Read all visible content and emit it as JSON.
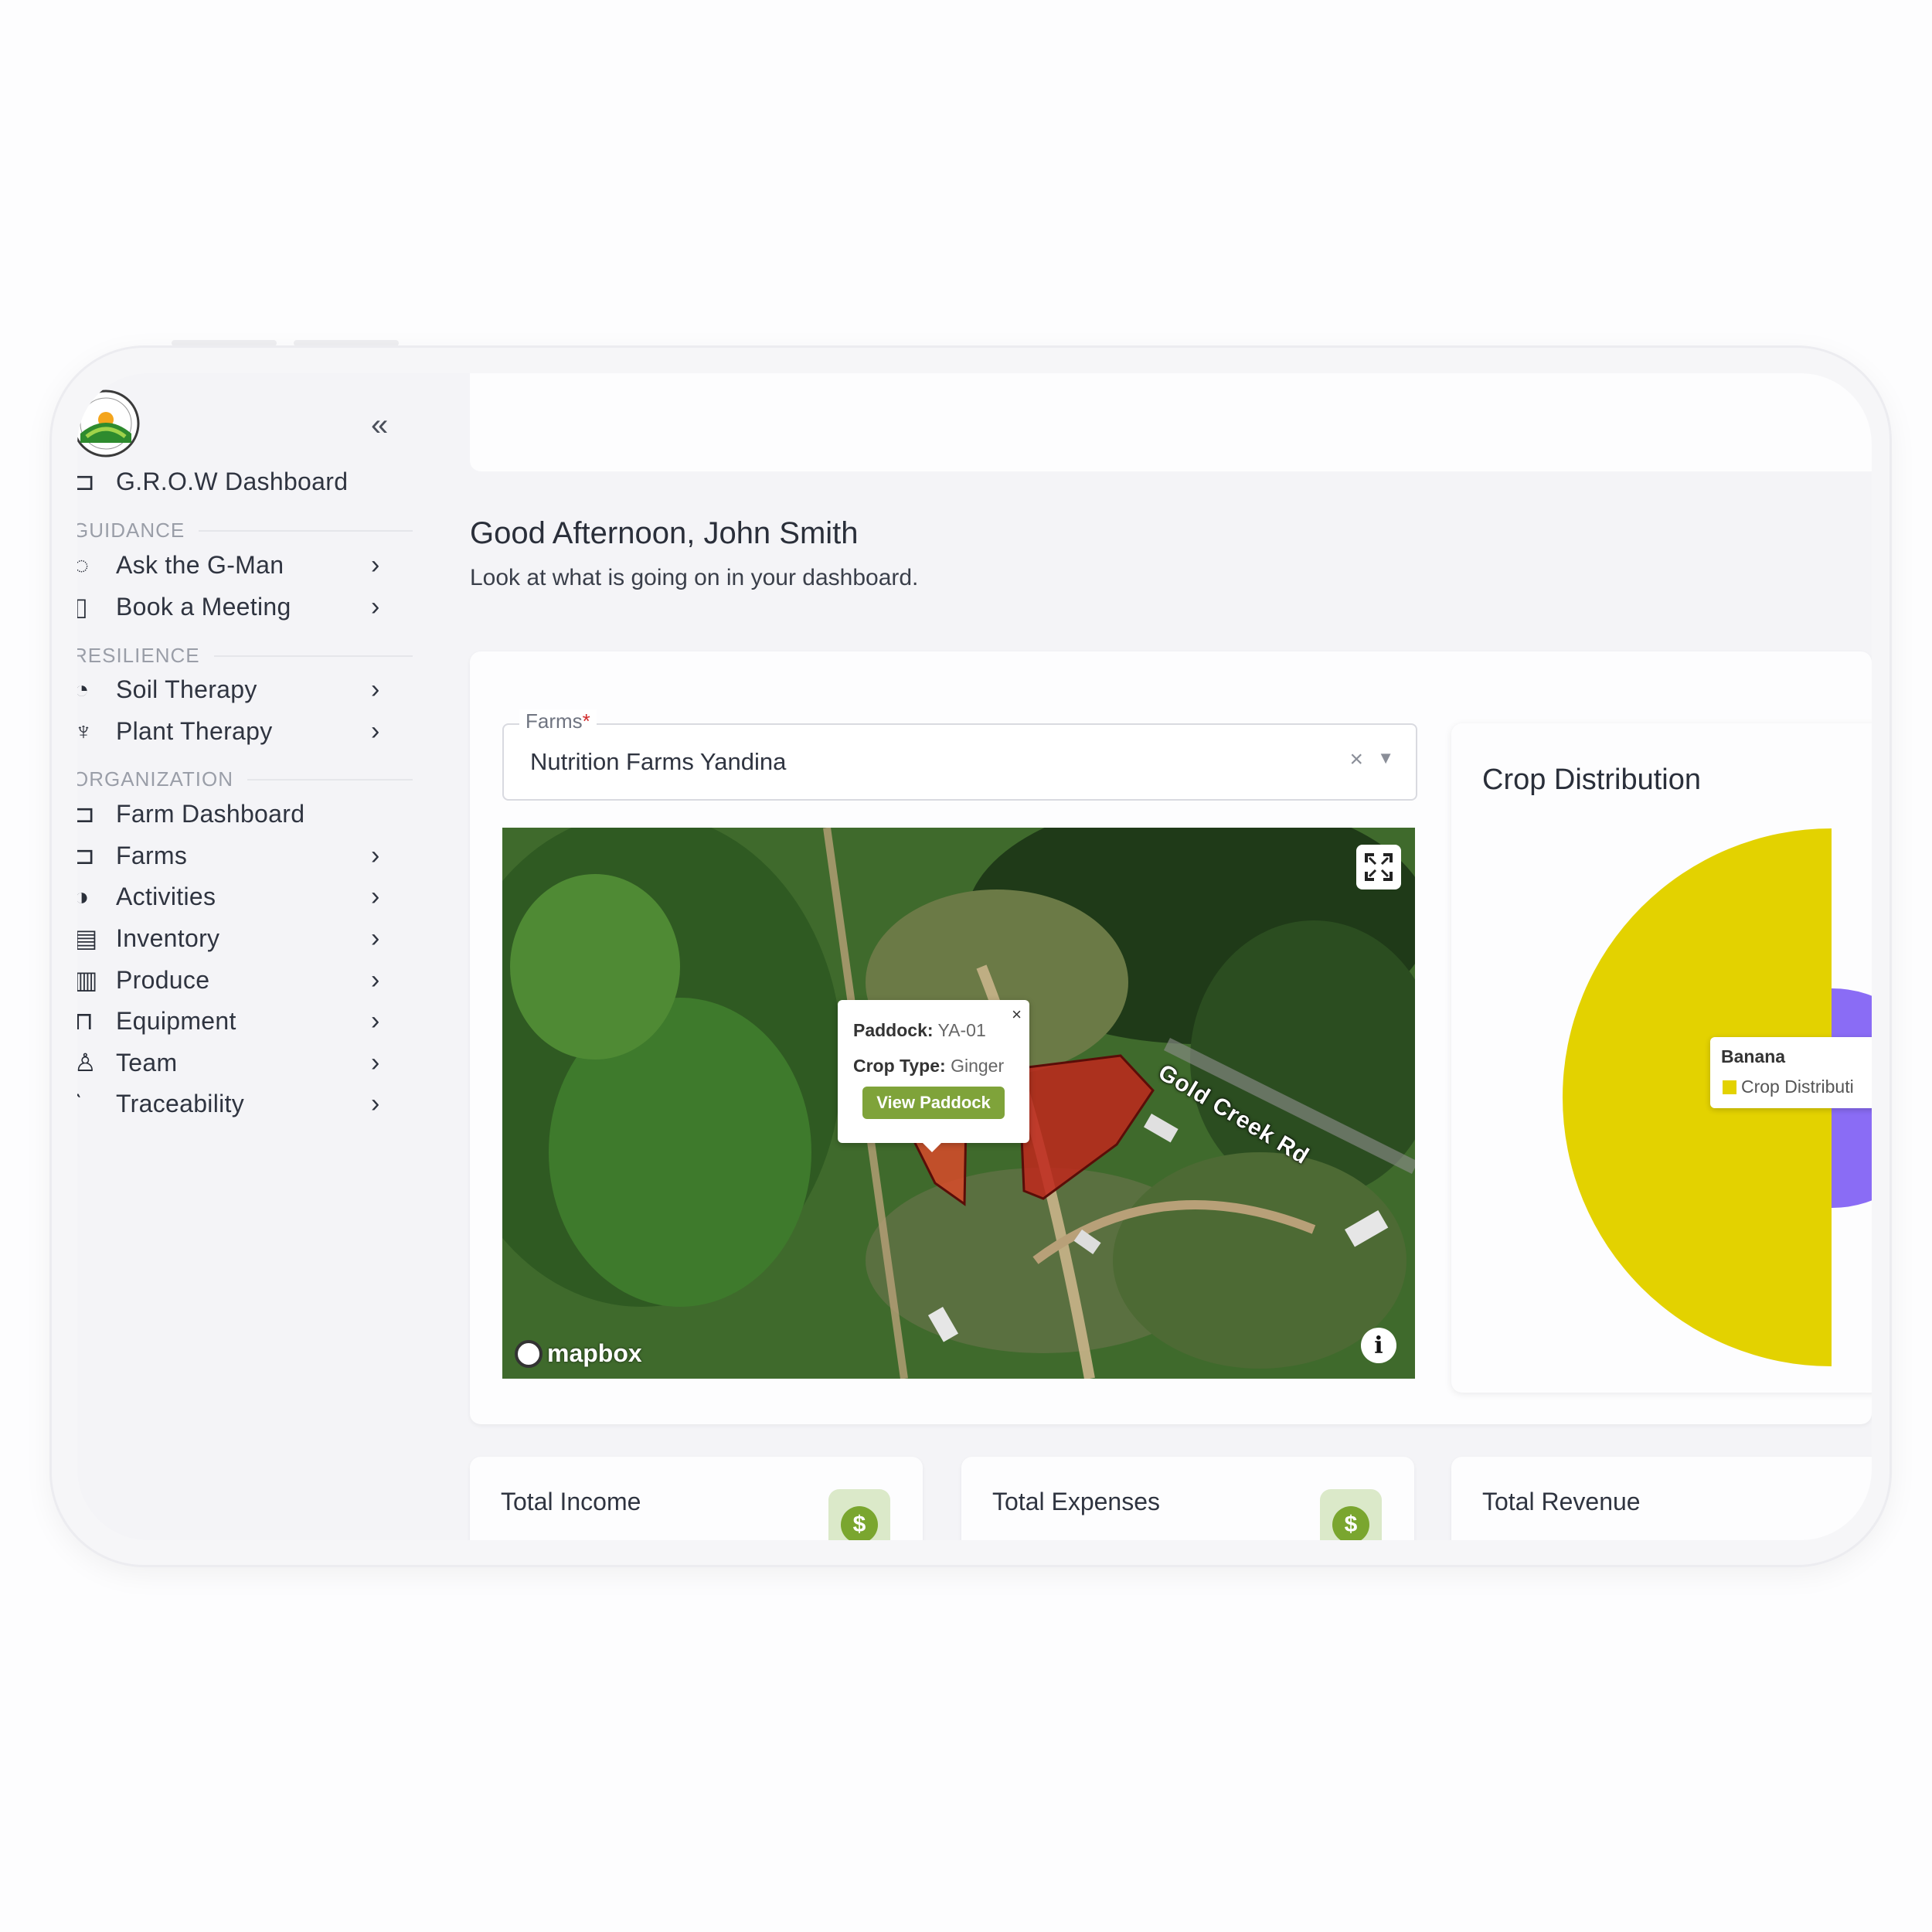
{
  "sidebar": {
    "items": [
      {
        "label": "G.R.O.W Dashboard",
        "icon": "dashboard-icon",
        "chevron": false
      },
      {
        "label": "Ask the G-Man",
        "icon": "chat-icon",
        "chevron": true
      },
      {
        "label": "Book a Meeting",
        "icon": "calendar-icon",
        "chevron": true
      },
      {
        "label": "Soil Therapy",
        "icon": "soil-icon",
        "chevron": true
      },
      {
        "label": "Plant Therapy",
        "icon": "plant-icon",
        "chevron": true
      },
      {
        "label": "Farm Dashboard",
        "icon": "farm-dashboard-icon",
        "chevron": false
      },
      {
        "label": "Farms",
        "icon": "farms-icon",
        "chevron": true
      },
      {
        "label": "Activities",
        "icon": "activities-icon",
        "chevron": true
      },
      {
        "label": "Inventory",
        "icon": "inventory-icon",
        "chevron": true
      },
      {
        "label": "Produce",
        "icon": "produce-icon",
        "chevron": true
      },
      {
        "label": "Equipment",
        "icon": "equipment-icon",
        "chevron": true
      },
      {
        "label": "Team",
        "icon": "team-icon",
        "chevron": true
      },
      {
        "label": "Traceability",
        "icon": "traceability-icon",
        "chevron": true
      }
    ],
    "sections": [
      "GUIDANCE",
      "RESILIENCE",
      "ORGANIZATION"
    ]
  },
  "header": {
    "greeting": "Good Afternoon, John Smith",
    "subtitle": "Look at what is going on in your dashboard."
  },
  "farm_select": {
    "label": "Farms",
    "required_mark": "*",
    "value": "Nutrition Farms Yandina",
    "clear": "×",
    "caret": "▼"
  },
  "map": {
    "road_label": "Gold Creek Rd",
    "attribution": "mapbox",
    "info": "i",
    "popup": {
      "paddock_label": "Paddock:",
      "paddock_value": "YA-01",
      "crop_label": "Crop Type:",
      "crop_value": "Ginger",
      "button": "View Paddock",
      "close": "×"
    },
    "paddock_color": "#c0271c"
  },
  "crop_distribution": {
    "title": "Crop Distribution",
    "tooltip_title": "Banana",
    "tooltip_series": "Crop Distributi",
    "colors": {
      "banana": "#e3d200",
      "other": "#8a6cf5"
    }
  },
  "stats": [
    {
      "label": "Total Income",
      "icon": "$"
    },
    {
      "label": "Total Expenses",
      "icon": "$"
    },
    {
      "label": "Total Revenue",
      "icon": "$"
    }
  ],
  "colors": {
    "accent_green": "#7aa62f",
    "page_bg": "#f4f4f7"
  }
}
